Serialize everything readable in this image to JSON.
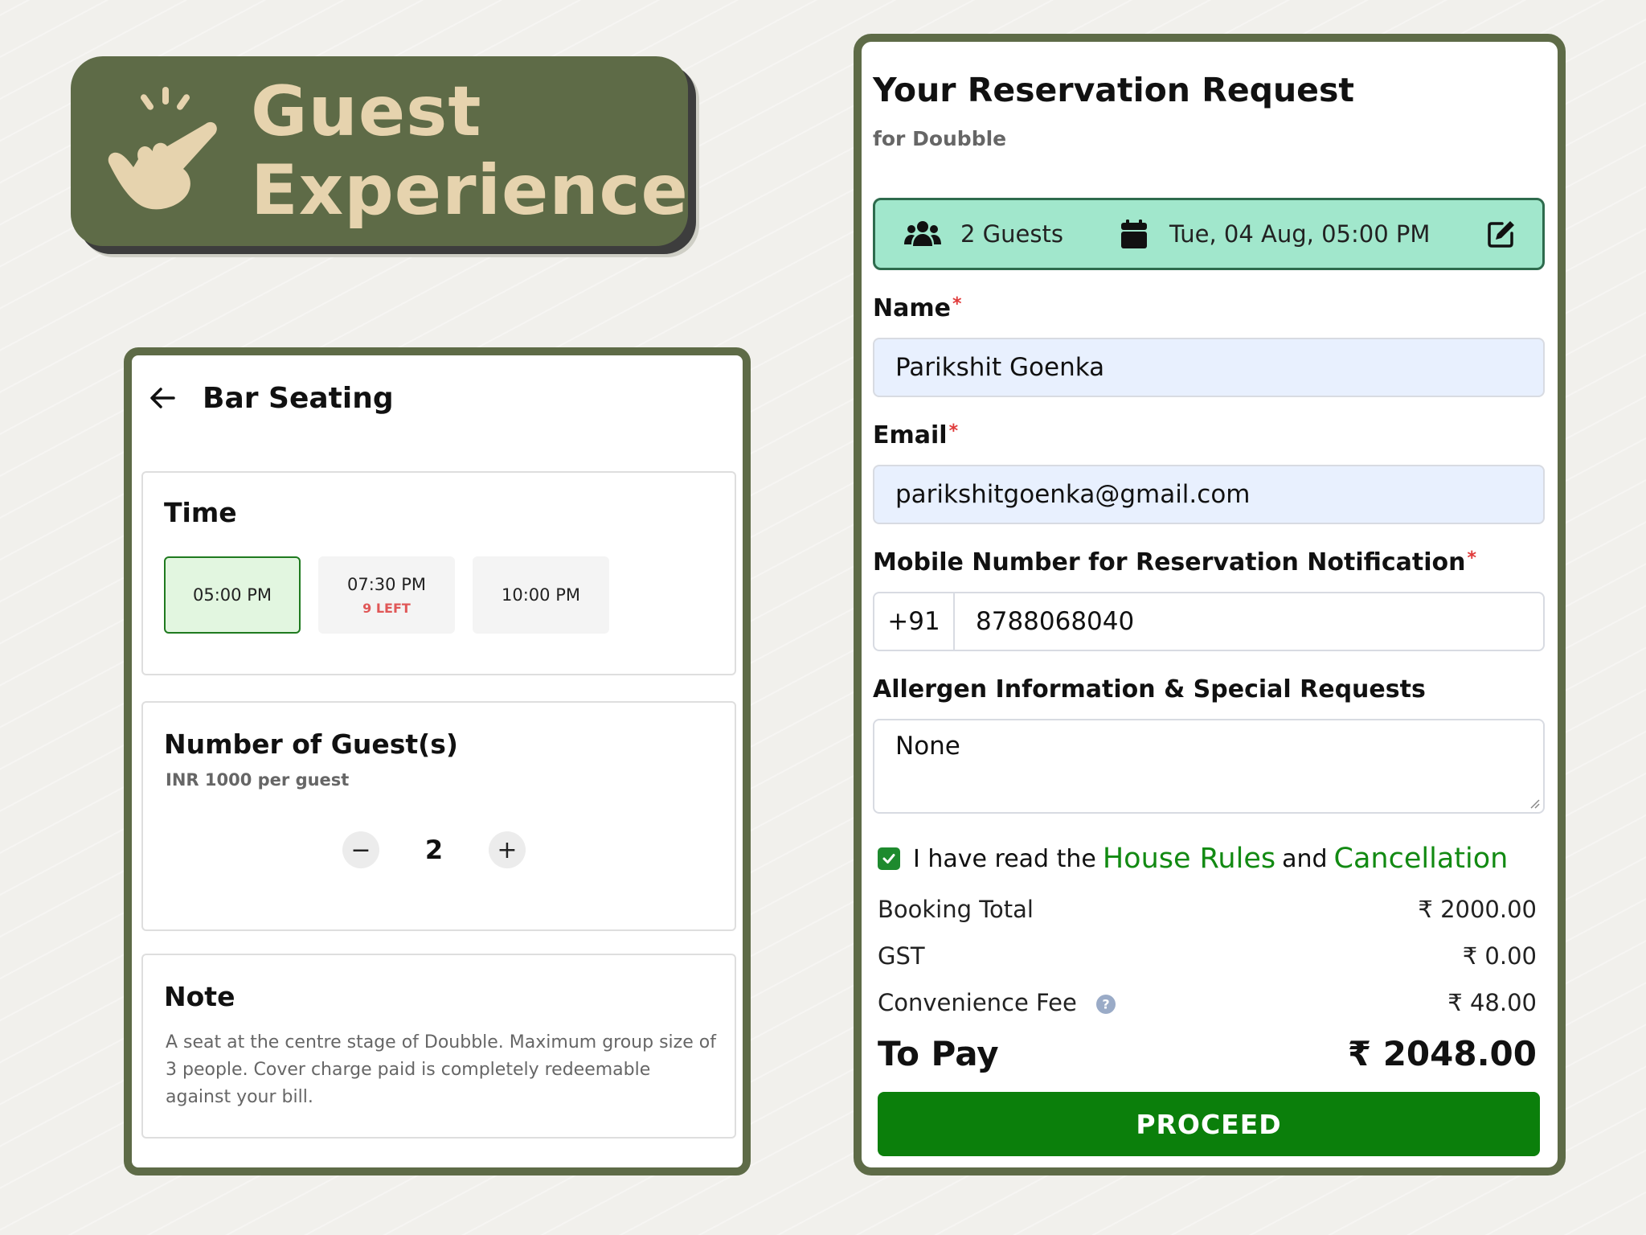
{
  "banner": {
    "title_line1": "Guest",
    "title_line2": "Experience",
    "icon": "tapping-hand-icon",
    "bg_color": "#5e6b47",
    "text_color": "#e6d3ae"
  },
  "bar_seating": {
    "title": "Bar Seating",
    "time_section": {
      "title": "Time",
      "slots": [
        {
          "time": "05:00 PM",
          "selected": true,
          "availability": ""
        },
        {
          "time": "07:30 PM",
          "selected": false,
          "availability": "9 LEFT"
        },
        {
          "time": "10:00 PM",
          "selected": false,
          "availability": ""
        }
      ]
    },
    "guests_section": {
      "title": "Number of Guest(s)",
      "subtitle": "INR 1000 per guest",
      "decrement": "−",
      "count": "2",
      "increment": "+"
    },
    "note_section": {
      "title": "Note",
      "text": "A seat at the centre stage of Doubble. Maximum group size of 3 people. Cover charge paid is completely redeemable against your bill."
    }
  },
  "reservation": {
    "title": "Your Reservation Request",
    "subtitle": "for Doubble",
    "summary": {
      "guests": "2 Guests",
      "datetime": "Tue, 04 Aug, 05:00 PM",
      "bg_color": "#a1e7cc"
    },
    "name": {
      "label": "Name",
      "required": "*",
      "value": "Parikshit Goenka"
    },
    "email": {
      "label": "Email",
      "required": "*",
      "value": "parikshitgoenka@gmail.com"
    },
    "mobile": {
      "label": "Mobile Number for Reservation Notification",
      "required": "*",
      "code": "+91",
      "value": "8788068040"
    },
    "allergen": {
      "label": "Allergen Information & Special Requests",
      "value": "None"
    },
    "agree": {
      "checked": true,
      "text_prefix": "I have read the",
      "link1": "House Rules",
      "text_mid": "and",
      "link2": "Cancellation",
      "link_color": "#128a12"
    },
    "pricing": {
      "booking_total_label": "Booking Total",
      "booking_total_value": "₹ 2000.00",
      "gst_label": "GST",
      "gst_value": "₹ 0.00",
      "convenience_label": "Convenience Fee",
      "convenience_value": "₹ 48.00",
      "to_pay_label": "To Pay",
      "to_pay_value": "₹ 2048.00"
    },
    "proceed_label": "PROCEED",
    "proceed_color": "#0b7f0b"
  }
}
